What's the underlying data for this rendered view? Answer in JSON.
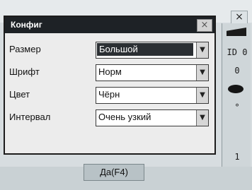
{
  "window": {
    "outer_close_label": "×"
  },
  "dialog": {
    "title": "Конфиг",
    "close_label": "×",
    "fields": [
      {
        "label": "Размер",
        "value": "Большой"
      },
      {
        "label": "Шрифт",
        "value": "Норм"
      },
      {
        "label": "Цвет",
        "value": "Чёрн"
      },
      {
        "label": "Интервал",
        "value": "Очень узкий"
      }
    ],
    "ok_label": "Да(F4)"
  },
  "side_panel": {
    "items": [
      "ID 0",
      "0",
      "° ",
      "1"
    ]
  },
  "colors": {
    "titlebar": "#1e2226",
    "highlight": "#2b2f33"
  }
}
